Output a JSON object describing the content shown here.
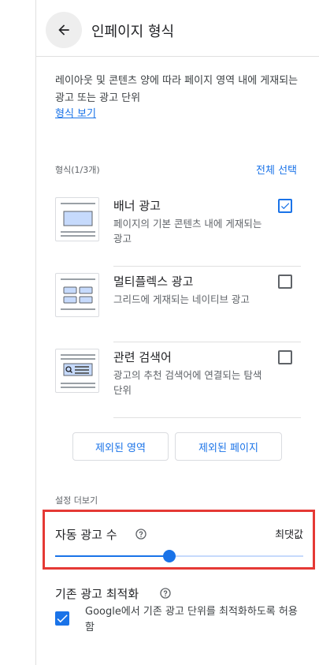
{
  "header": {
    "title": "인페이지 형식",
    "back_icon": "arrow-back-icon"
  },
  "intro": {
    "description": "레이아웃 및 콘텐츠 양에 따라 페이지 영역 내에 게재되는 광고 또는 광고 단위",
    "link_label": "형식 보기"
  },
  "formats": {
    "label": "형식(1/3개)",
    "select_all_label": "전체 선택",
    "items": [
      {
        "title": "배너 광고",
        "description": "페이지의 기본 콘텐츠 내에 게재되는 광고",
        "checked": true
      },
      {
        "title": "멀티플렉스 광고",
        "description": "그리드에 게재되는 네이티브 광고",
        "checked": false
      },
      {
        "title": "관련 검색어",
        "description": "광고의 추천 검색어에 연결되는 탐색 단위",
        "checked": false
      }
    ]
  },
  "buttons": {
    "excluded_areas": "제외된 영역",
    "excluded_pages": "제외된 페이지"
  },
  "more_settings": {
    "label": "설정 더보기",
    "auto_ads": {
      "label": "자동 광고 수",
      "value_label": "최댓값",
      "slider_value_fraction": 0.46
    },
    "optimize": {
      "title": "기존 광고 최적화",
      "checked": true,
      "description": "Google에서 기존 광고 단위를 최적화하도록 허용함"
    }
  },
  "colors": {
    "accent": "#1a73e8",
    "highlight": "#e53935"
  }
}
